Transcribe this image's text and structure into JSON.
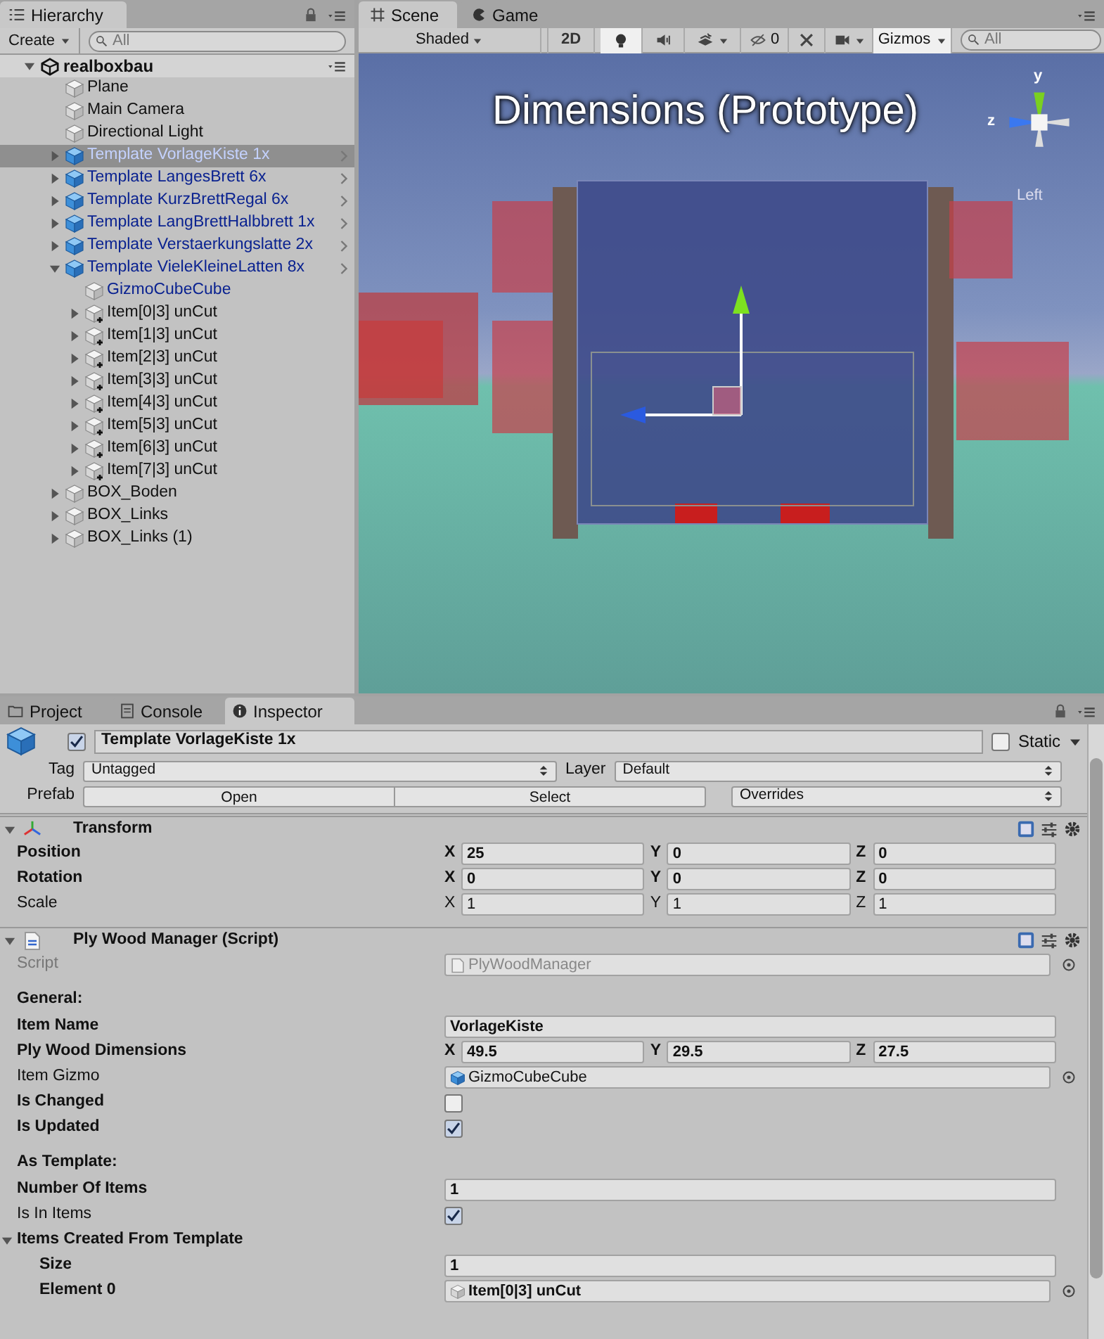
{
  "hierarchy": {
    "title": "Hierarchy",
    "create_button": "Create",
    "search": {
      "placeholder": "All"
    },
    "scene": {
      "label": "realboxbau",
      "expanded": true,
      "children": [
        {
          "label": "Plane",
          "kind": "gameobject",
          "selected": false
        },
        {
          "label": "Main Camera",
          "kind": "gameobject",
          "selected": false
        },
        {
          "label": "Directional Light",
          "kind": "gameobject",
          "selected": false
        },
        {
          "label": "Template VorlageKiste 1x",
          "kind": "prefab",
          "expanded": false,
          "selected": true
        },
        {
          "label": "Template LangesBrett 6x",
          "kind": "prefab",
          "expanded": false,
          "selected": false
        },
        {
          "label": "Template KurzBrettRegal 6x",
          "kind": "prefab",
          "expanded": false,
          "selected": false
        },
        {
          "label": "Template LangBrettHalbbrett 1x",
          "kind": "prefab",
          "expanded": false,
          "selected": false
        },
        {
          "label": "Template Verstaerkungslatte 2x",
          "kind": "prefab",
          "expanded": false,
          "selected": false
        },
        {
          "label": "Template VieleKleineLatten 8x",
          "kind": "prefab",
          "expanded": true,
          "selected": false,
          "children": [
            {
              "label": "GizmoCubeCube",
              "kind": "prefab_child",
              "selected": false
            },
            {
              "label": "Item[0|3] unCut",
              "kind": "added_object",
              "expanded": false,
              "selected": false
            },
            {
              "label": "Item[1|3] unCut",
              "kind": "added_object",
              "expanded": false,
              "selected": false
            },
            {
              "label": "Item[2|3] unCut",
              "kind": "added_object",
              "expanded": false,
              "selected": false
            },
            {
              "label": "Item[3|3] unCut",
              "kind": "added_object",
              "expanded": false,
              "selected": false
            },
            {
              "label": "Item[4|3] unCut",
              "kind": "added_object",
              "expanded": false,
              "selected": false
            },
            {
              "label": "Item[5|3] unCut",
              "kind": "added_object",
              "expanded": false,
              "selected": false
            },
            {
              "label": "Item[6|3] unCut",
              "kind": "added_object",
              "expanded": false,
              "selected": false
            },
            {
              "label": "Item[7|3] unCut",
              "kind": "added_object",
              "expanded": false,
              "selected": false
            }
          ]
        },
        {
          "label": "BOX_Boden",
          "kind": "gameobject",
          "expanded": false,
          "selected": false
        },
        {
          "label": "BOX_Links",
          "kind": "gameobject",
          "expanded": false,
          "selected": false
        },
        {
          "label": "BOX_Links (1)",
          "kind": "gameobject",
          "expanded": false,
          "selected": false
        }
      ]
    }
  },
  "scene_view": {
    "tabs": [
      {
        "label": "Scene",
        "kind": "scene",
        "selected": true
      },
      {
        "label": "Game",
        "kind": "game",
        "selected": false
      }
    ],
    "toolbar": {
      "shading": "Shaded",
      "mode_2d": "2D",
      "lighting": true,
      "audio": false,
      "hidden_count": "0",
      "gizmos": "Gizmos",
      "search": {
        "placeholder": "All"
      }
    },
    "overlay_title": "Dimensions (Prototype)",
    "gizmo": {
      "y_label": "y",
      "z_label": "z",
      "view_label": "Left"
    }
  },
  "inspector": {
    "tabs": [
      {
        "label": "Project",
        "kind": "project",
        "selected": false
      },
      {
        "label": "Console",
        "kind": "console",
        "selected": false
      },
      {
        "label": "Inspector",
        "kind": "inspector",
        "selected": true
      }
    ],
    "object": {
      "active": true,
      "name": "Template VorlageKiste 1x",
      "static_label": "Static",
      "static": false,
      "tag_label": "Tag",
      "tag": "Untagged",
      "layer_label": "Layer",
      "layer": "Default",
      "prefab_label": "Prefab",
      "prefab_buttons": [
        "Open",
        "Select"
      ],
      "overrides": "Overrides"
    },
    "components": [
      {
        "title": "Transform",
        "kind": "transform",
        "expanded": true,
        "rows": [
          {
            "label": "Position",
            "kind": "vector3",
            "modified": true,
            "disabled": false,
            "values": [
              {
                "axis": "X",
                "value": "25"
              },
              {
                "axis": "Y",
                "value": "0"
              },
              {
                "axis": "Z",
                "value": "0"
              }
            ]
          },
          {
            "label": "Rotation",
            "kind": "vector3",
            "modified": true,
            "disabled": false,
            "values": [
              {
                "axis": "X",
                "value": "0"
              },
              {
                "axis": "Y",
                "value": "0"
              },
              {
                "axis": "Z",
                "value": "0"
              }
            ]
          },
          {
            "label": "Scale",
            "kind": "vector3",
            "modified": false,
            "disabled": false,
            "values": [
              {
                "axis": "X",
                "value": "1"
              },
              {
                "axis": "Y",
                "value": "1"
              },
              {
                "axis": "Z",
                "value": "1"
              }
            ]
          }
        ]
      },
      {
        "title": "Ply Wood Manager (Script)",
        "kind": "script",
        "expanded": true,
        "rows": [
          {
            "label": "Script",
            "kind": "script_ref",
            "modified": false,
            "disabled": true,
            "value": "PlyWoodManager"
          },
          {
            "label": "General:",
            "kind": "header"
          },
          {
            "label": "Item Name",
            "kind": "text",
            "modified": true,
            "disabled": false,
            "value": "VorlageKiste"
          },
          {
            "label": "Ply Wood Dimensions",
            "kind": "vector3",
            "modified": true,
            "disabled": false,
            "values": [
              {
                "axis": "X",
                "value": "49.5"
              },
              {
                "axis": "Y",
                "value": "29.5"
              },
              {
                "axis": "Z",
                "value": "27.5"
              }
            ]
          },
          {
            "label": "Item Gizmo",
            "kind": "prefab_ref",
            "modified": false,
            "disabled": false,
            "value": "GizmoCubeCube"
          },
          {
            "label": "Is Changed",
            "kind": "checkbox",
            "modified": true,
            "disabled": false,
            "checked": false
          },
          {
            "label": "Is Updated",
            "kind": "checkbox",
            "modified": true,
            "disabled": false,
            "checked": true
          },
          {
            "label": "As Template:",
            "kind": "header"
          },
          {
            "label": "Number Of Items",
            "kind": "text",
            "modified": true,
            "disabled": false,
            "value": "1"
          },
          {
            "label": "Is In Items",
            "kind": "checkbox",
            "modified": false,
            "disabled": false,
            "checked": true
          },
          {
            "label": "Items Created From Template",
            "kind": "foldout",
            "modified": true,
            "disabled": false,
            "expanded": true,
            "children": [
              {
                "label": "Size",
                "kind": "text",
                "modified": true,
                "disabled": false,
                "value": "1"
              },
              {
                "label": "Element 0",
                "kind": "object_ref",
                "modified": true,
                "disabled": false,
                "value": "Item[0|3] unCut"
              }
            ]
          }
        ]
      }
    ]
  }
}
